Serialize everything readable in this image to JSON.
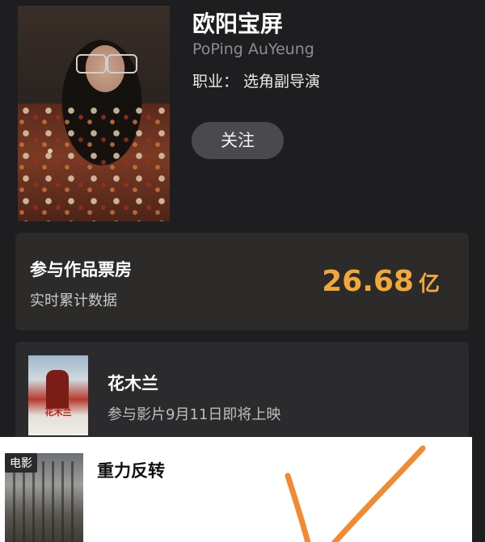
{
  "profile": {
    "name": "欧阳宝屏",
    "english_name": "PoPing AuYeung",
    "job": "职业：  选角副导演",
    "follow_label": "关注"
  },
  "box_office": {
    "title": "参与作品票房",
    "subtitle": "实时累计数据",
    "value": "26.68",
    "unit": "亿",
    "value_color": "#f2a73b"
  },
  "movies": [
    {
      "title": "花木兰",
      "subtitle": "参与影片9月11日即将上映",
      "poster_text": "花木兰"
    }
  ],
  "overlay": {
    "badge": "电影",
    "title": "重力反转",
    "subtitle": "",
    "mark_color": "#f28a32"
  }
}
